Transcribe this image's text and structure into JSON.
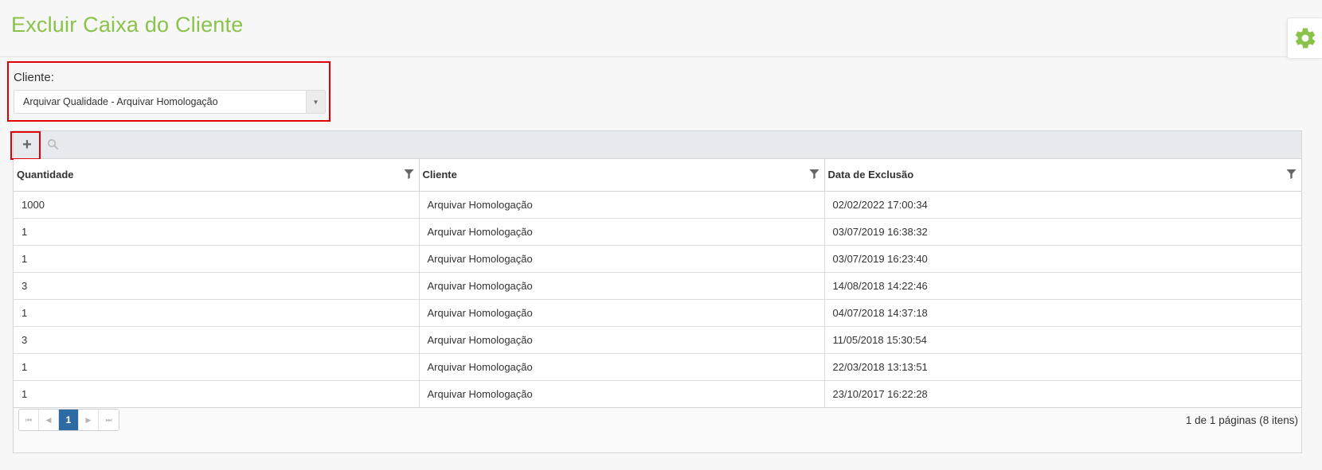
{
  "page": {
    "title": "Excluir Caixa do Cliente",
    "accent_color": "#8bc34a",
    "settings_icon": "gear-icon"
  },
  "client_filter": {
    "label": "Cliente:",
    "selected_value": "Arquivar Qualidade - Arquivar Homologação",
    "arrow_glyph": "▼"
  },
  "toolbar": {
    "add_glyph": "+",
    "add_icon": "plus-icon",
    "search_icon": "search-icon"
  },
  "table": {
    "columns": [
      {
        "label": "Quantidade",
        "filter_icon": "filter-icon"
      },
      {
        "label": "Cliente",
        "filter_icon": "filter-icon"
      },
      {
        "label": "Data de Exclusão",
        "filter_icon": "filter-icon"
      }
    ],
    "rows": [
      {
        "quantidade": "1000",
        "cliente": "Arquivar Homologação",
        "data": "02/02/2022 17:00:34"
      },
      {
        "quantidade": "1",
        "cliente": "Arquivar Homologação",
        "data": "03/07/2019 16:38:32"
      },
      {
        "quantidade": "1",
        "cliente": "Arquivar Homologação",
        "data": "03/07/2019 16:23:40"
      },
      {
        "quantidade": "3",
        "cliente": "Arquivar Homologação",
        "data": "14/08/2018 14:22:46"
      },
      {
        "quantidade": "1",
        "cliente": "Arquivar Homologação",
        "data": "04/07/2018 14:37:18"
      },
      {
        "quantidade": "3",
        "cliente": "Arquivar Homologação",
        "data": "11/05/2018 15:30:54"
      },
      {
        "quantidade": "1",
        "cliente": "Arquivar Homologação",
        "data": "22/03/2018 13:13:51"
      },
      {
        "quantidade": "1",
        "cliente": "Arquivar Homologação",
        "data": "23/10/2017 16:22:28"
      }
    ]
  },
  "pagination": {
    "first_glyph": "⏮",
    "prev_glyph": "◀",
    "current_page": "1",
    "next_glyph": "▶",
    "last_glyph": "⏭",
    "summary": "1 de 1 páginas (8 itens)",
    "current_color": "#2d6ba3"
  },
  "highlight_color": "#e00000"
}
